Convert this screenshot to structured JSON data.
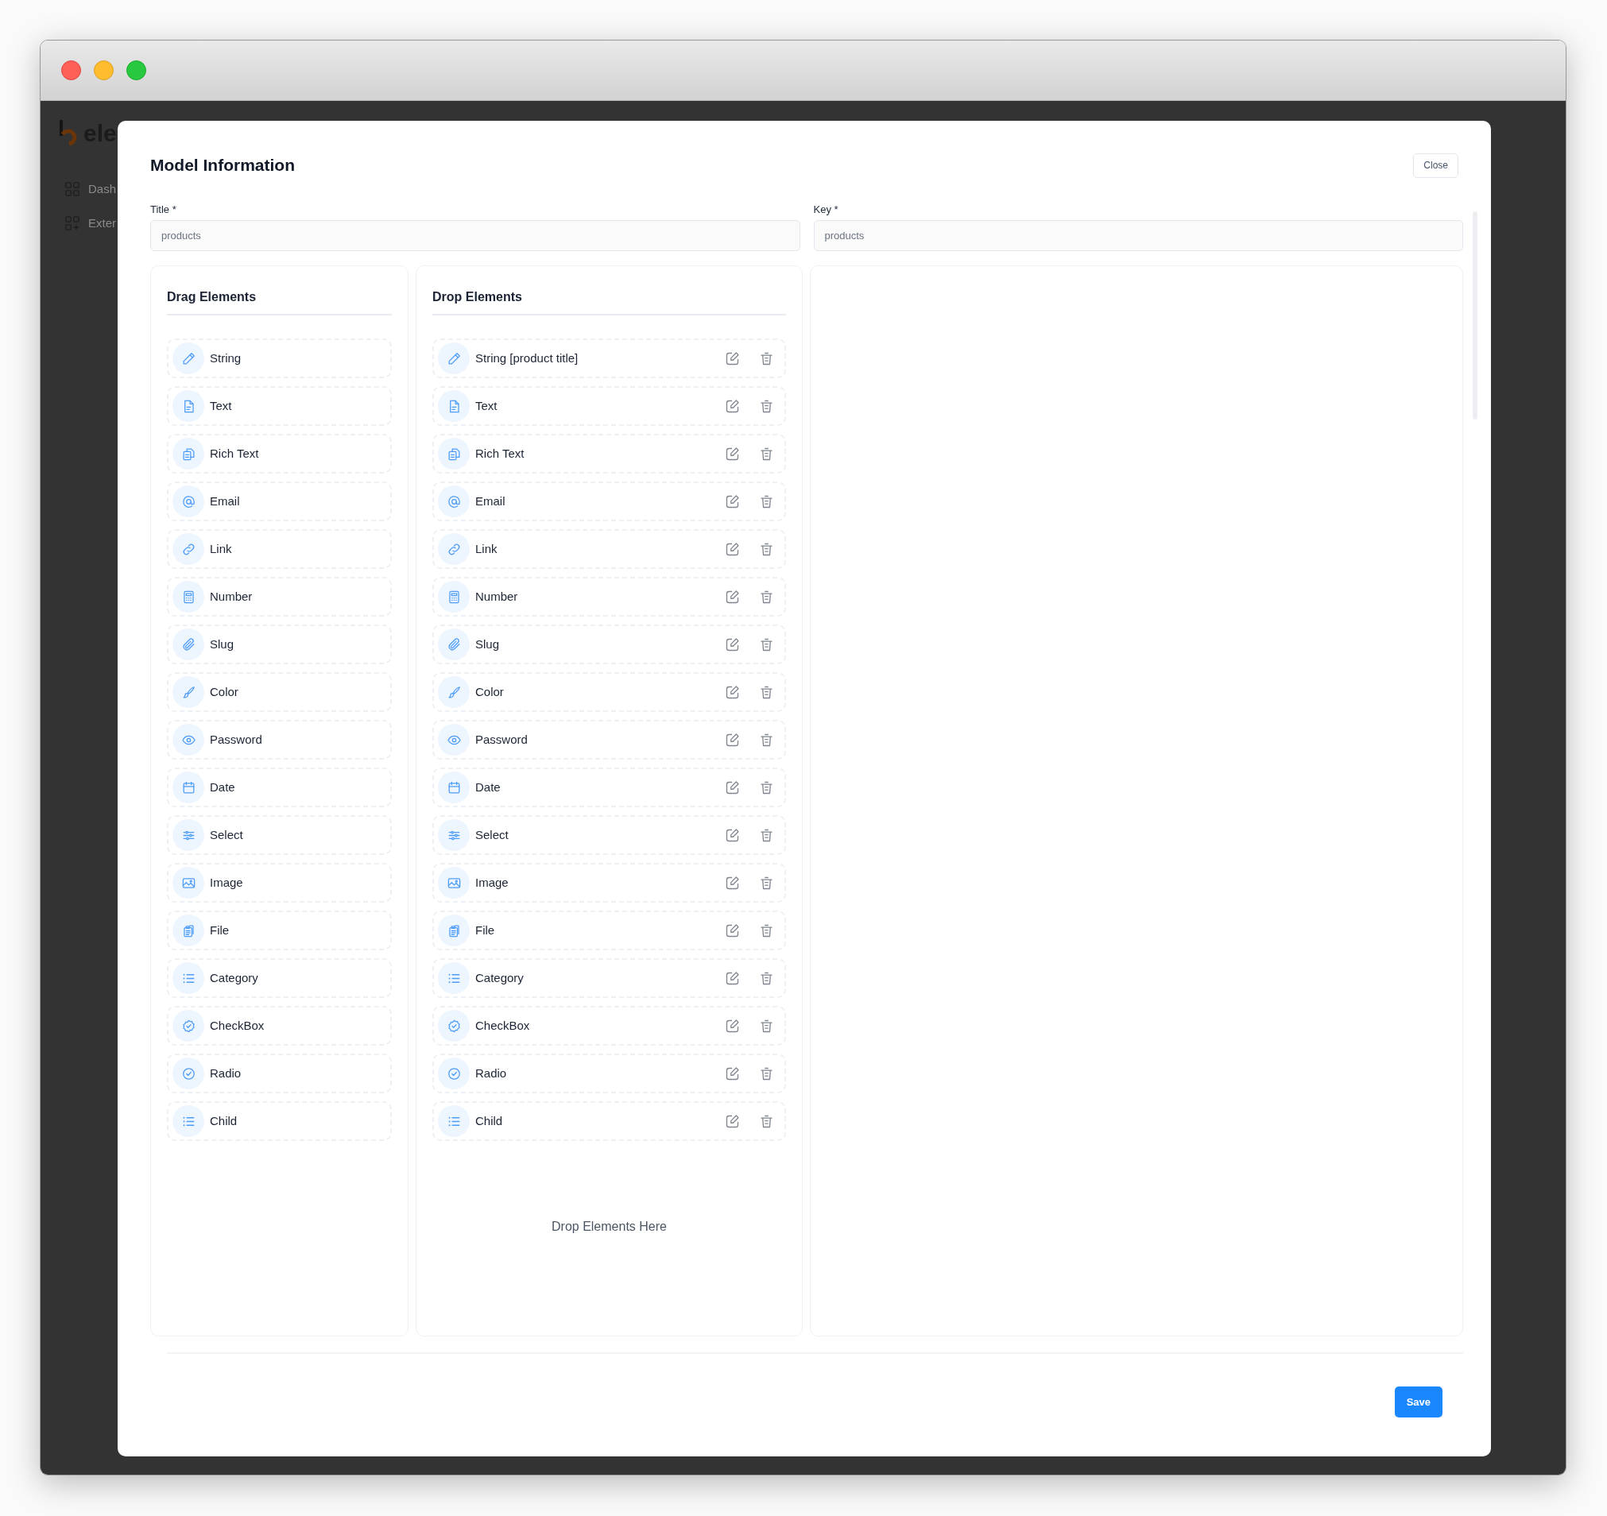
{
  "background_app": {
    "logo_text": "ele",
    "sidebar": [
      {
        "kind": "grid",
        "label": "Dash"
      },
      {
        "kind": "grid-plus",
        "label": "Exter"
      }
    ]
  },
  "modal": {
    "title": "Model Information",
    "close_button": "Close",
    "fields": [
      {
        "label": "Title *",
        "placeholder": "products"
      },
      {
        "label": "Key *",
        "placeholder": "products"
      }
    ],
    "drag_panel": {
      "heading": "Drag Elements",
      "items": [
        {
          "kind": "string",
          "label": "String"
        },
        {
          "kind": "text",
          "label": "Text"
        },
        {
          "kind": "rich-text",
          "label": "Rich Text"
        },
        {
          "kind": "email",
          "label": "Email"
        },
        {
          "kind": "link",
          "label": "Link"
        },
        {
          "kind": "number",
          "label": "Number"
        },
        {
          "kind": "slug",
          "label": "Slug"
        },
        {
          "kind": "color",
          "label": "Color"
        },
        {
          "kind": "password",
          "label": "Password"
        },
        {
          "kind": "date",
          "label": "Date"
        },
        {
          "kind": "select",
          "label": "Select"
        },
        {
          "kind": "image",
          "label": "Image"
        },
        {
          "kind": "file",
          "label": "File"
        },
        {
          "kind": "category",
          "label": "Category"
        },
        {
          "kind": "checkbox",
          "label": "CheckBox"
        },
        {
          "kind": "radio",
          "label": "Radio"
        },
        {
          "kind": "child",
          "label": "Child"
        }
      ]
    },
    "drop_panel": {
      "heading": "Drop Elements",
      "items": [
        {
          "kind": "string",
          "label": "String [product title]"
        },
        {
          "kind": "text",
          "label": "Text"
        },
        {
          "kind": "rich-text",
          "label": "Rich Text"
        },
        {
          "kind": "email",
          "label": "Email"
        },
        {
          "kind": "link",
          "label": "Link"
        },
        {
          "kind": "number",
          "label": "Number"
        },
        {
          "kind": "slug",
          "label": "Slug"
        },
        {
          "kind": "color",
          "label": "Color"
        },
        {
          "kind": "password",
          "label": "Password"
        },
        {
          "kind": "date",
          "label": "Date"
        },
        {
          "kind": "select",
          "label": "Select"
        },
        {
          "kind": "image",
          "label": "Image"
        },
        {
          "kind": "file",
          "label": "File"
        },
        {
          "kind": "category",
          "label": "Category"
        },
        {
          "kind": "checkbox",
          "label": "CheckBox"
        },
        {
          "kind": "radio",
          "label": "Radio"
        },
        {
          "kind": "child",
          "label": "Child"
        }
      ],
      "empty_hint": "Drop Elements Here"
    },
    "save_button": "Save"
  }
}
